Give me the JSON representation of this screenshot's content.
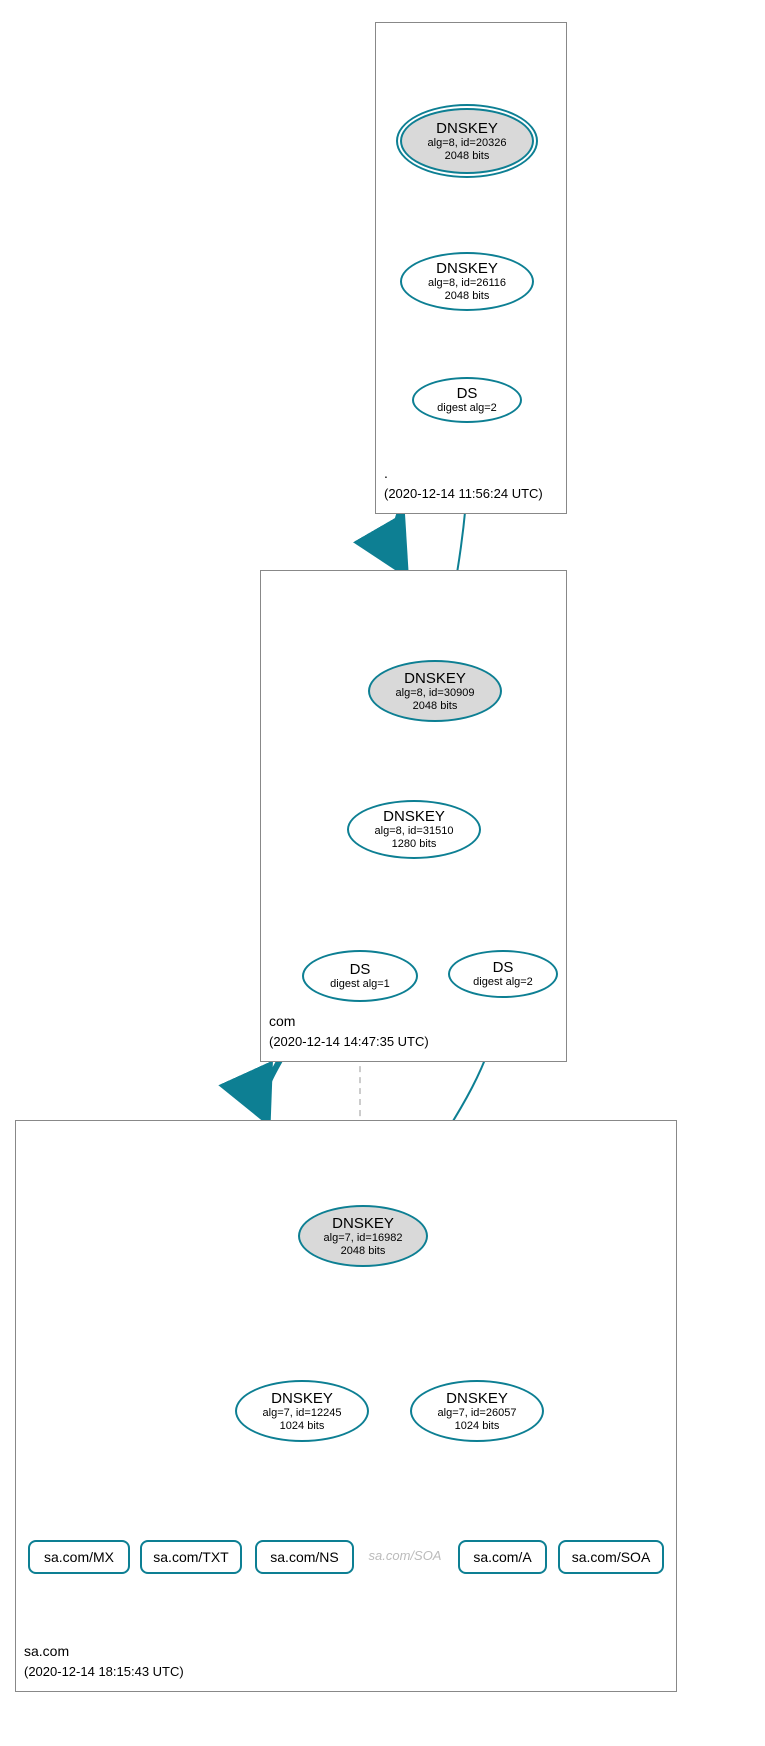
{
  "zones": {
    "root": {
      "name": ".",
      "date": "(2020-12-14 11:56:24 UTC)"
    },
    "com": {
      "name": "com",
      "date": "(2020-12-14 14:47:35 UTC)"
    },
    "sa": {
      "name": "sa.com",
      "date": "(2020-12-14 18:15:43 UTC)"
    }
  },
  "nodes": {
    "root_ksk": {
      "t": "DNSKEY",
      "l1": "alg=8, id=20326",
      "l2": "2048 bits"
    },
    "root_zsk": {
      "t": "DNSKEY",
      "l1": "alg=8, id=26116",
      "l2": "2048 bits"
    },
    "root_ds": {
      "t": "DS",
      "l1": "digest alg=2"
    },
    "com_ksk": {
      "t": "DNSKEY",
      "l1": "alg=8, id=30909",
      "l2": "2048 bits"
    },
    "com_zsk": {
      "t": "DNSKEY",
      "l1": "alg=8, id=31510",
      "l2": "1280 bits"
    },
    "com_ds1": {
      "t": "DS",
      "l1": "digest alg=1"
    },
    "com_ds2": {
      "t": "DS",
      "l1": "digest alg=2"
    },
    "sa_ksk": {
      "t": "DNSKEY",
      "l1": "alg=7, id=16982",
      "l2": "2048 bits"
    },
    "sa_zsk1": {
      "t": "DNSKEY",
      "l1": "alg=7, id=12245",
      "l2": "1024 bits"
    },
    "sa_zsk2": {
      "t": "DNSKEY",
      "l1": "alg=7, id=26057",
      "l2": "1024 bits"
    }
  },
  "rr": {
    "mx": "sa.com/MX",
    "txt": "sa.com/TXT",
    "ns": "sa.com/NS",
    "soa_ghost": "sa.com/SOA",
    "a": "sa.com/A",
    "soa": "sa.com/SOA"
  }
}
